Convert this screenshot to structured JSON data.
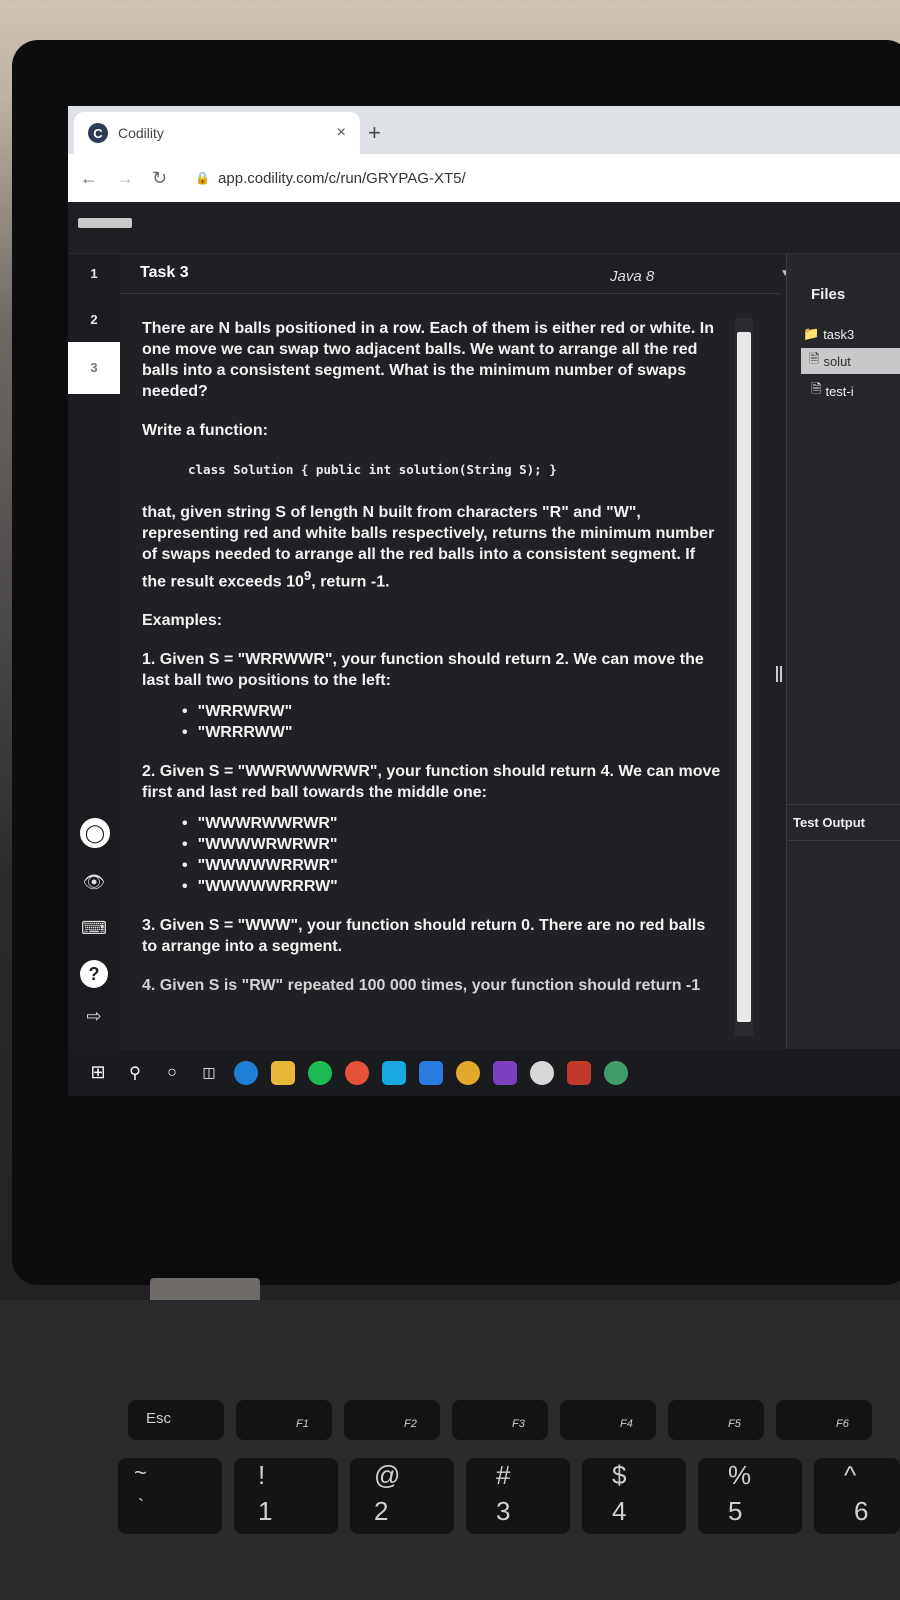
{
  "browser": {
    "tab_title": "Codility",
    "tab_close": "×",
    "new_tab": "+",
    "url": "app.codility.com/c/run/GRYPAG-XT5/"
  },
  "rail": {
    "task_numbers": [
      "1",
      "2",
      "3"
    ],
    "active_task": "3"
  },
  "task": {
    "title": "Task 3",
    "language": "Java 8",
    "paragraphs": {
      "intro": "There are N balls positioned in a row. Each of them is either red or white. In one move we can swap two adjacent balls. We want to arrange all the red balls into a consistent segment. What is the minimum number of swaps needed?",
      "write": "Write a function:",
      "code": "class Solution { public int solution(String S); }",
      "desc_pre": "that, given string S of length N built from characters \"R\" and \"W\", representing red and white balls respectively, returns the minimum number of swaps needed to arrange all the red balls into a consistent segment. If the result exceeds 10",
      "desc_exp": "9",
      "desc_post": ", return -1.",
      "examples_heading": "Examples:",
      "ex1": "1. Given S = \"WRRWWR\", your function should return 2. We can move the last ball two positions to the left:",
      "ex1_items": [
        "\"WRRWRW\"",
        "\"WRRRWW\""
      ],
      "ex2": "2. Given S = \"WWRWWWRWR\", your function should return 4. We can move first and last red ball towards the middle one:",
      "ex2_items": [
        "\"WWWRWWRWR\"",
        "\"WWWWRWRWR\"",
        "\"WWWWWRRWR\"",
        "\"WWWWWRRRW\""
      ],
      "ex3": "3. Given S = \"WWW\", your function should return 0. There are no red balls to arrange into a segment.",
      "ex4": "4. Given S is \"RW\" repeated 100 000 times, your function should return -1"
    }
  },
  "files": {
    "heading": "Files",
    "folder": "task3",
    "items": [
      "solut",
      "test-i"
    ],
    "test_output": "Test Output"
  },
  "taskbar": {
    "apps": [
      "windows-start",
      "search",
      "cortana",
      "task-view",
      "edge",
      "file-explorer",
      "spotify",
      "media",
      "whatsapp",
      "app-blue",
      "chrome",
      "onenote",
      "slack",
      "calendar",
      "browser-green"
    ]
  },
  "keyboard": {
    "esc": "Esc",
    "f_keys": [
      "F1",
      "F2",
      "F3",
      "F4",
      "F5",
      "F6"
    ],
    "number_row": [
      {
        "top": "~",
        "bottom": "`"
      },
      {
        "top": "!",
        "bottom": "1"
      },
      {
        "top": "@",
        "bottom": "2"
      },
      {
        "top": "#",
        "bottom": "3"
      },
      {
        "top": "$",
        "bottom": "4"
      },
      {
        "top": "%",
        "bottom": "5"
      },
      {
        "top": "^",
        "bottom": "6"
      }
    ]
  },
  "colors": {
    "editor_bg": "#202124",
    "text": "#f2f2f2",
    "selected_file_bg": "#c9c9cc"
  }
}
